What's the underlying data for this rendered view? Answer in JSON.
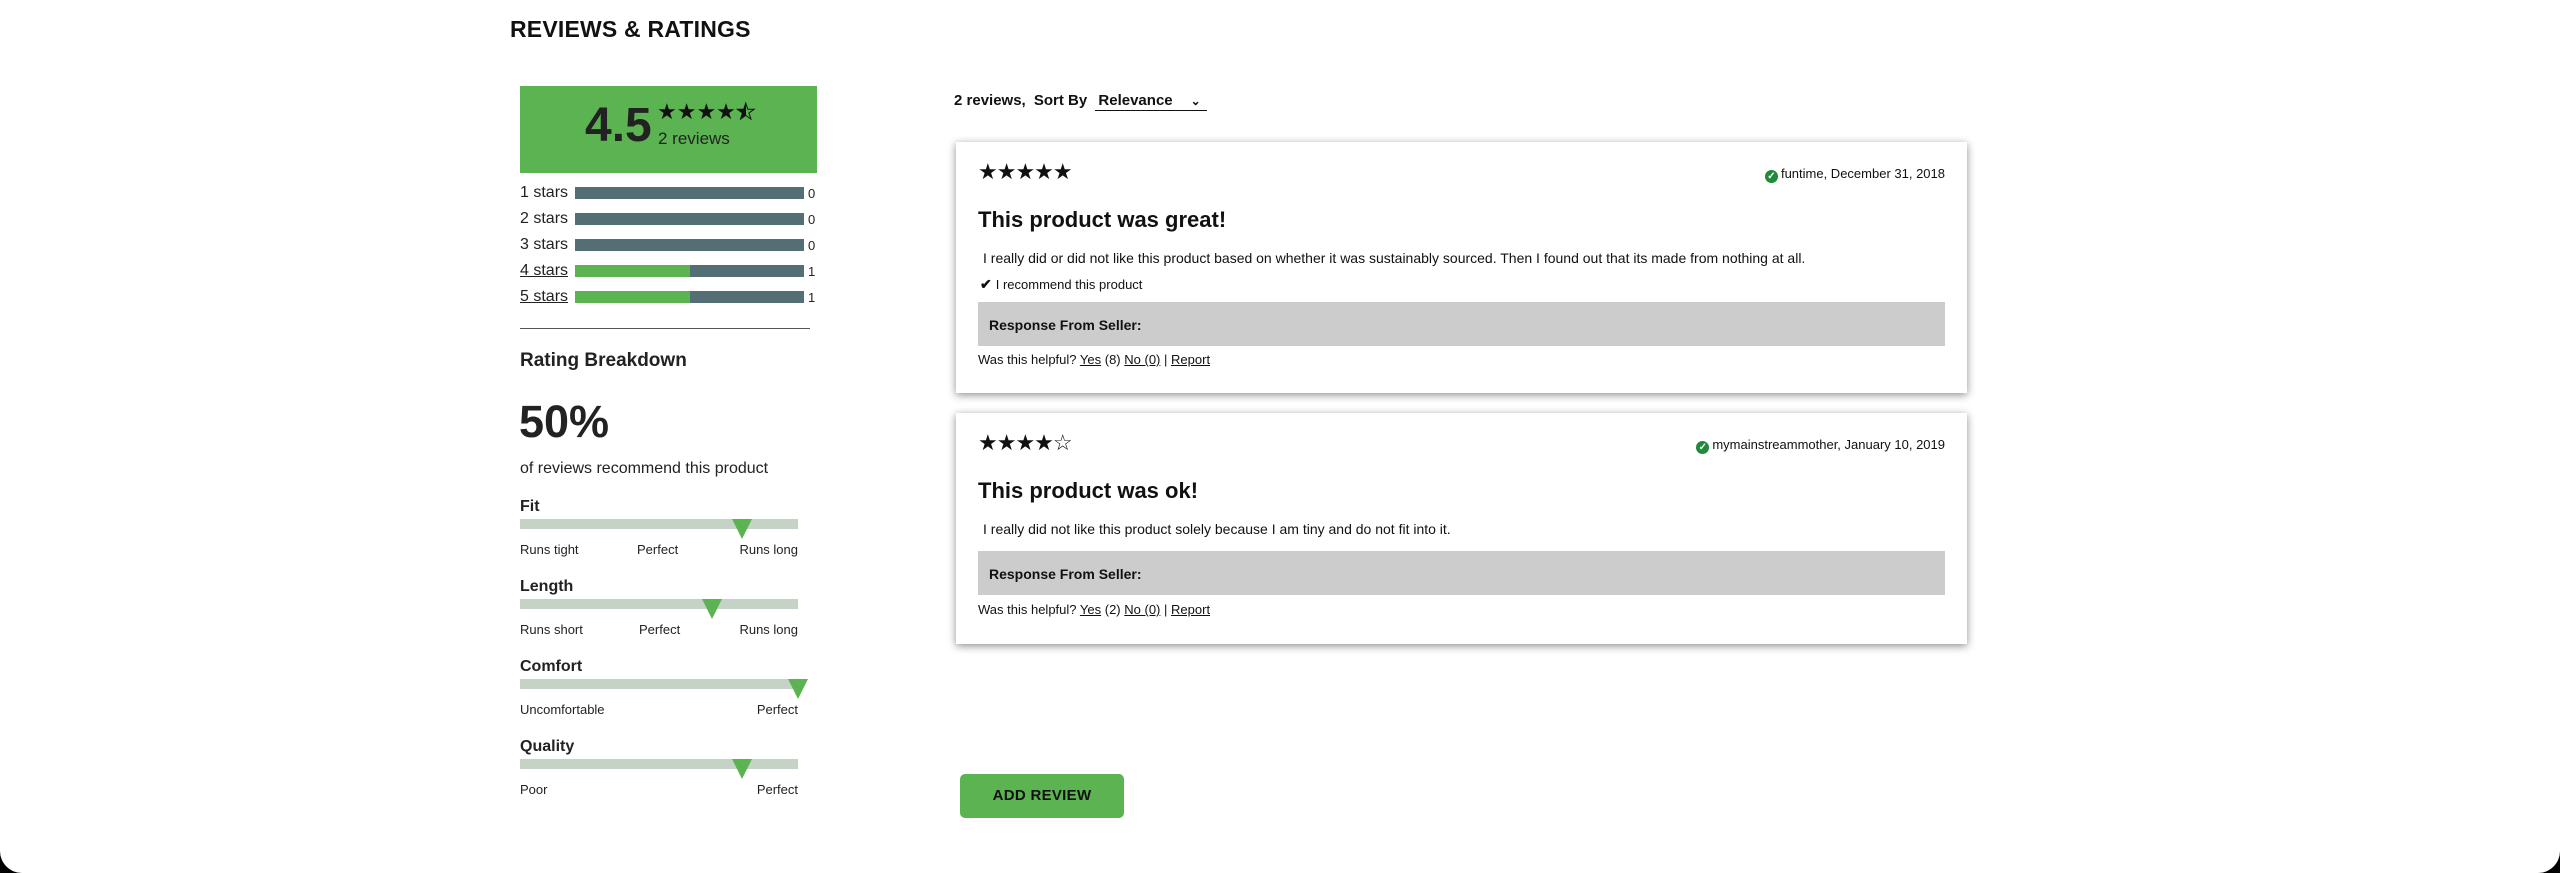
{
  "section_title": "REVIEWS & RATINGS",
  "summary": {
    "average": "4.5",
    "average_value": 4.5,
    "stars": "★★★★",
    "half_star": "★",
    "review_count": "2 reviews"
  },
  "distribution": [
    {
      "label": "1 stars",
      "count": "0",
      "fraction": 0,
      "link": false
    },
    {
      "label": "2 stars",
      "count": "0",
      "fraction": 0,
      "link": false
    },
    {
      "label": "3 stars",
      "count": "0",
      "fraction": 0,
      "link": false
    },
    {
      "label": "4 stars",
      "count": "1",
      "fraction": 0.5,
      "link": true
    },
    {
      "label": "5 stars",
      "count": "1",
      "fraction": 0.5,
      "link": true
    }
  ],
  "breakdown": {
    "title": "Rating Breakdown",
    "percent": "50%",
    "recommend_text": "of reviews recommend this product"
  },
  "characteristics": [
    {
      "name": "Fit",
      "value": 0.8,
      "labels": [
        "Runs tight",
        "Perfect",
        "Runs long"
      ]
    },
    {
      "name": "Length",
      "value": 0.69,
      "labels": [
        "Runs short",
        "Perfect",
        "Runs long"
      ]
    },
    {
      "name": "Comfort",
      "value": 1.0,
      "labels": [
        "Uncomfortable",
        "Perfect"
      ]
    },
    {
      "name": "Quality",
      "value": 0.8,
      "labels": [
        "Poor",
        "Perfect"
      ]
    }
  ],
  "reviews_header": {
    "count": "2 reviews,",
    "sort_by": "Sort By",
    "sort_value": "Relevance"
  },
  "reviews": [
    {
      "stars": "★★★★★",
      "rating": 5,
      "user": "funtime, December 31, 2018",
      "title": "This product was great!",
      "body": "I really did or did not like this product based on whether it was sustainably sourced. Then I found out that its made from nothing at all.",
      "recommend": "I recommend this product",
      "seller_label": "Response From Seller:",
      "helpful_prefix": "Was this helpful?",
      "yes": "Yes",
      "yes_count": "(8)",
      "no": "No (0)",
      "sep": "|",
      "report": "Report"
    },
    {
      "stars": "★★★★☆",
      "rating": 4,
      "user": "mymainstreammother, January 10, 2019",
      "title": "This product was ok!",
      "body": "I really did not like this product solely because I am tiny and do not fit into it.",
      "recommend": "",
      "seller_label": "Response From Seller:",
      "helpful_prefix": "Was this helpful?",
      "yes": "Yes",
      "yes_count": "(2)",
      "no": "No (0)",
      "sep": "|",
      "report": "Report"
    }
  ],
  "add_review": "ADD REVIEW",
  "colors": {
    "accent_green": "#5cb352",
    "bar_gray": "#546e76",
    "seller_bg": "#cccccc",
    "track_bg": "#c5d3c7"
  }
}
